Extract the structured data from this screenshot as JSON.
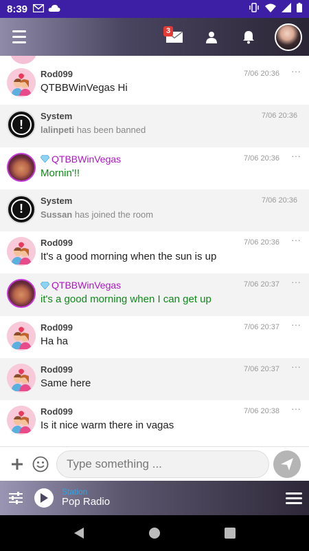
{
  "status_bar": {
    "time": "8:39",
    "left_icons": [
      "gmail-icon",
      "cloud-icon"
    ],
    "right_icons": [
      "vibrate-icon",
      "wifi-icon",
      "signal-icon",
      "battery-icon"
    ]
  },
  "header": {
    "menu_icon": "hamburger-icon",
    "mail_badge": "3",
    "icons": [
      "mail-icon",
      "user-icon",
      "bell-icon"
    ],
    "colors": {
      "gradient_start": "#8e8aa8",
      "gradient_end": "#2a2535"
    }
  },
  "messages": [
    {
      "type": "user",
      "avatar": "couple",
      "username": "Rod099",
      "time": "7/06 20:36",
      "text": "QTBBWinVegas Hi",
      "more": "···"
    },
    {
      "type": "system",
      "username": "System",
      "time": "7/06 20:36",
      "subject": "lalinpeti",
      "text": "has been banned"
    },
    {
      "type": "vip",
      "avatar": "lady",
      "username": "QTBBWinVegas",
      "time": "7/06 20:36",
      "text": "Mornin'!!",
      "more": "···"
    },
    {
      "type": "system",
      "username": "System",
      "time": "7/06 20:36",
      "subject": "Sussan",
      "text": "has joined the room"
    },
    {
      "type": "user",
      "avatar": "couple",
      "username": "Rod099",
      "time": "7/06 20:36",
      "text": "It's a good morning when the sun is up",
      "more": "···"
    },
    {
      "type": "vip",
      "avatar": "lady",
      "username": "QTBBWinVegas",
      "time": "7/06 20:37",
      "text": "it's a good morning when I can get up",
      "more": "···"
    },
    {
      "type": "user",
      "avatar": "couple",
      "username": "Rod099",
      "time": "7/06 20:37",
      "text": "Ha ha",
      "more": "···"
    },
    {
      "type": "user",
      "avatar": "couple",
      "username": "Rod099",
      "time": "7/06 20:37",
      "text": "Same here",
      "more": "···"
    },
    {
      "type": "user",
      "avatar": "couple",
      "username": "Rod099",
      "time": "7/06 20:38",
      "text": "Is it nice warm there in vagas",
      "more": "···"
    }
  ],
  "composer": {
    "placeholder": "Type something ...",
    "value": "",
    "icons": [
      "plus-icon",
      "emoji-icon",
      "send-icon"
    ]
  },
  "radio": {
    "station_label": "Station",
    "station_name": "Pop Radio",
    "icons": [
      "equalizer-icon",
      "play-icon",
      "menu-icon"
    ],
    "accent_color": "#2aa7e8"
  },
  "nav": {
    "icons": [
      "back-icon",
      "home-icon",
      "recents-icon"
    ]
  },
  "colors": {
    "status_bar": "#3c1fa5",
    "vip_username": "#b015c7",
    "green_text": "#0e8a18",
    "badge": "#e53935"
  }
}
